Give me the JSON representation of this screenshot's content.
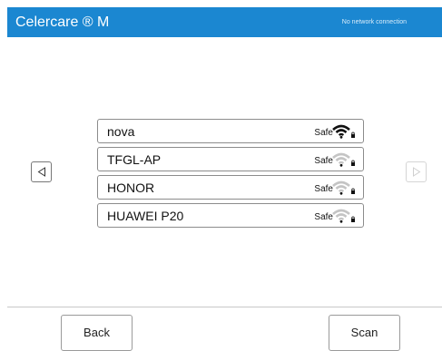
{
  "header": {
    "app_title": "Celercare ® M",
    "network_status": "No network connection",
    "accent": "#1b87d1"
  },
  "nav": {
    "prev_icon": "triangle-left-icon",
    "next_icon": "triangle-right-icon",
    "next_enabled": false
  },
  "networks": [
    {
      "ssid": "nova",
      "security": "Safe",
      "signal_bars": 3,
      "locked": true
    },
    {
      "ssid": "TFGL-AP",
      "security": "Safe",
      "signal_bars": 1,
      "locked": true
    },
    {
      "ssid": "HONOR",
      "security": "Safe",
      "signal_bars": 1,
      "locked": true
    },
    {
      "ssid": "HUAWEI P20",
      "security": "Safe",
      "signal_bars": 1,
      "locked": true
    }
  ],
  "footer": {
    "back_label": "Back",
    "scan_label": "Scan"
  }
}
